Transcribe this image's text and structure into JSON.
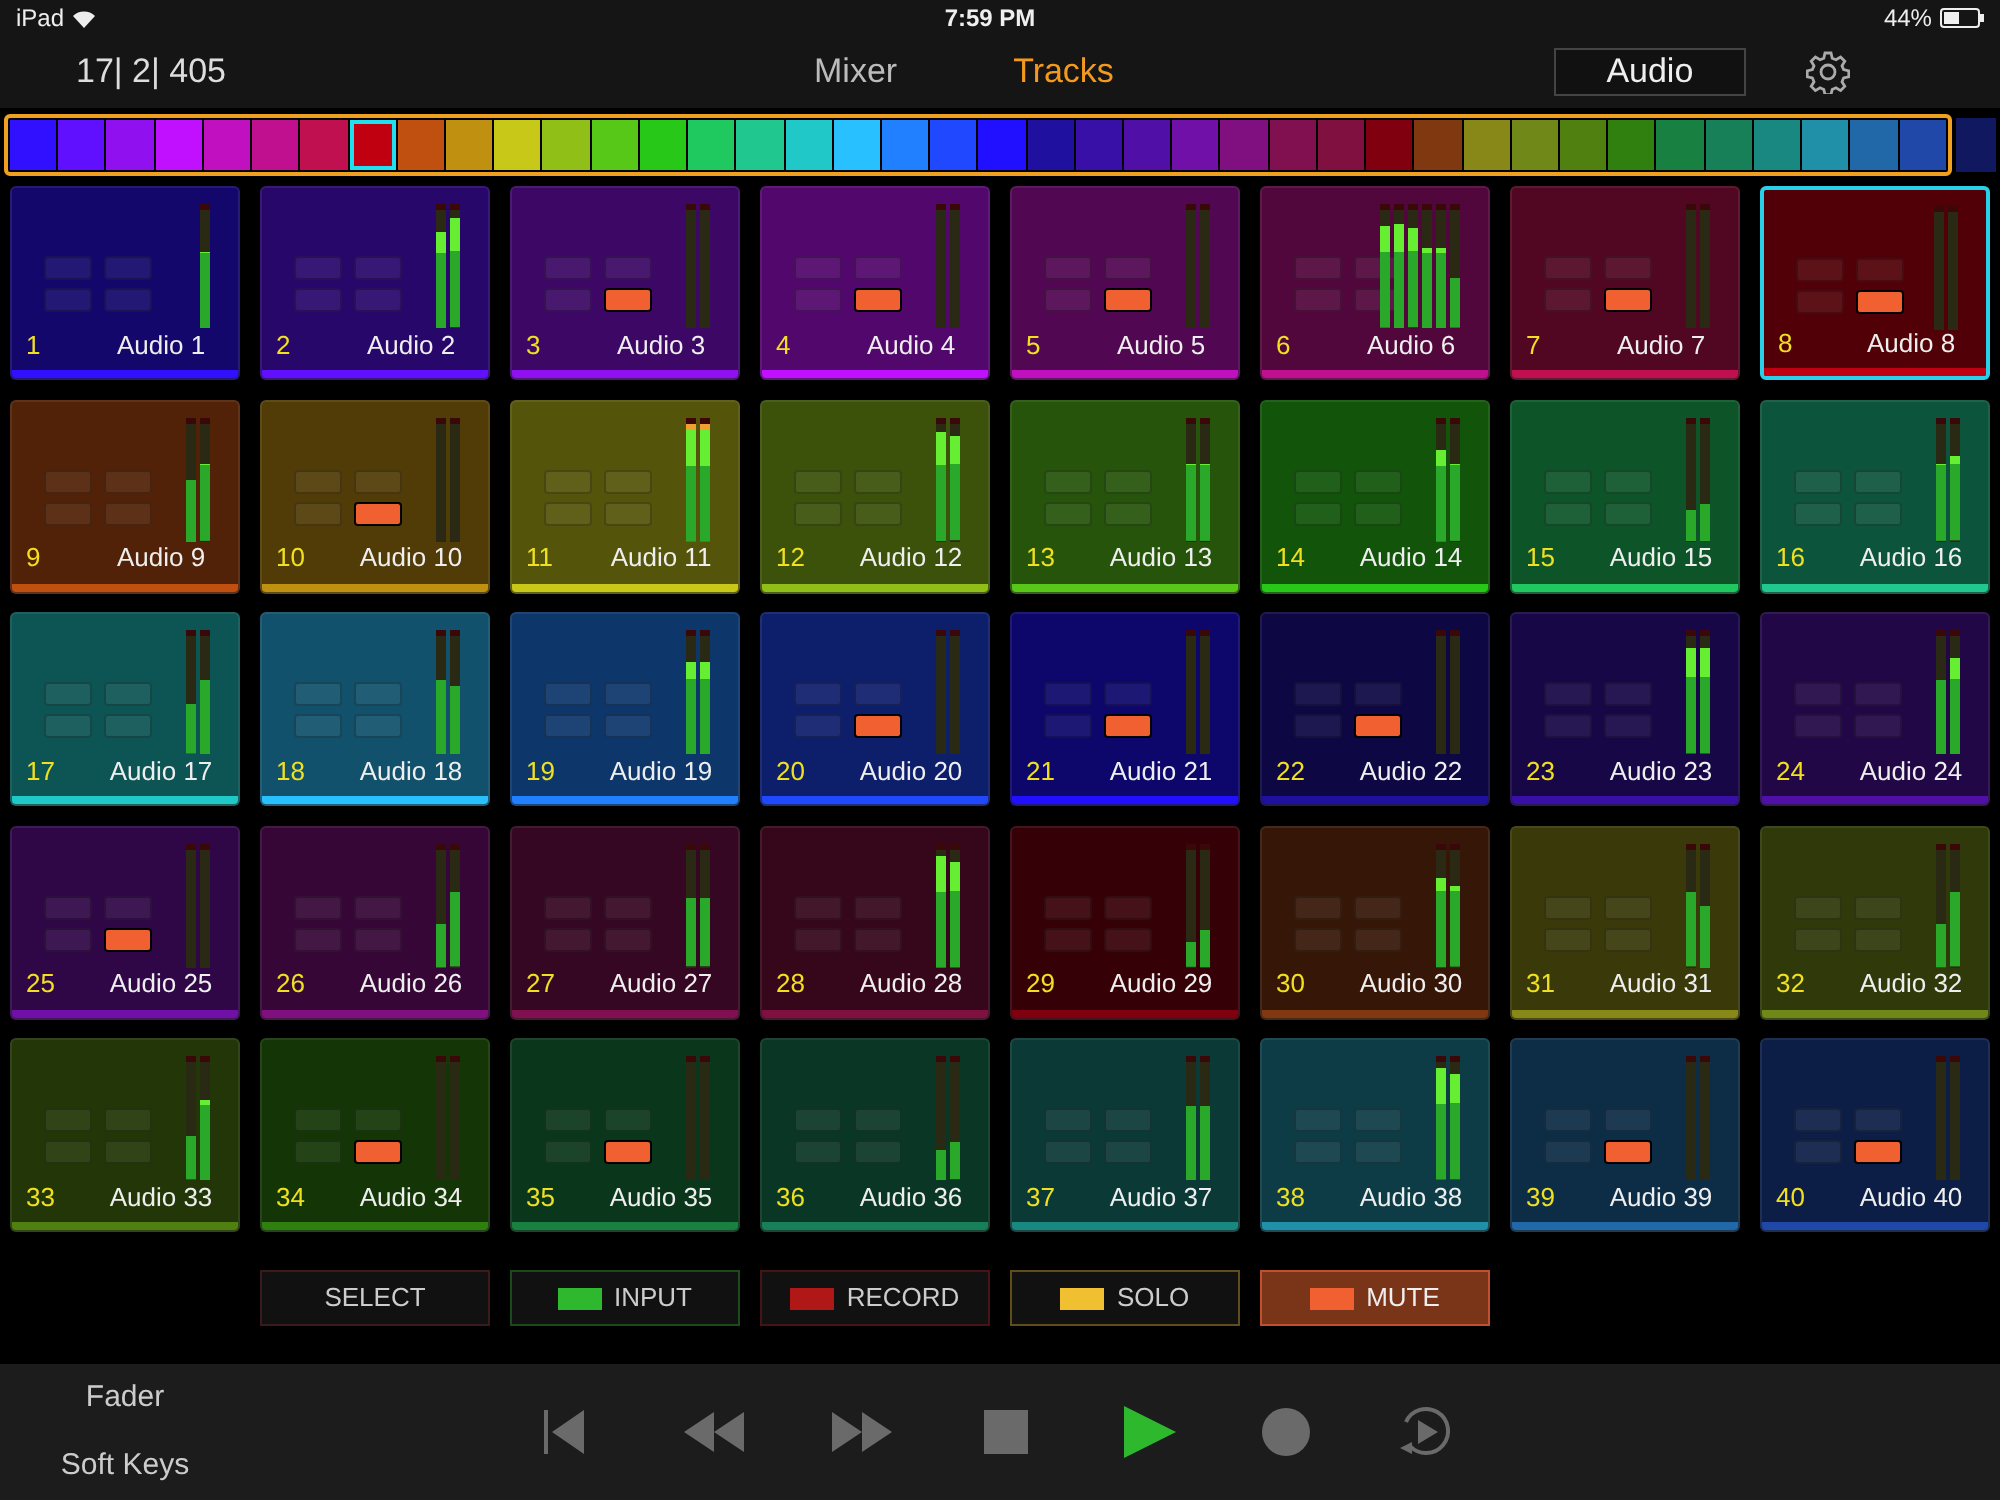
{
  "status_bar": {
    "device": "iPad",
    "time": "7:59 PM",
    "battery": "44%"
  },
  "header": {
    "position": "17| 2| 405",
    "tabs": [
      {
        "label": "Mixer",
        "selected": false
      },
      {
        "label": "Tracks",
        "selected": true
      }
    ],
    "bank_button": "Audio"
  },
  "tracks": [
    {
      "number": "1",
      "name": "Audio 1",
      "color": "#3010ff",
      "muted": false,
      "selected": false,
      "meters": [
        {
          "level": 0.62
        }
      ]
    },
    {
      "number": "2",
      "name": "Audio 2",
      "color": "#6010ff",
      "muted": false,
      "selected": false,
      "meters": [
        {
          "level": 0.78
        },
        {
          "level": 0.88
        }
      ]
    },
    {
      "number": "3",
      "name": "Audio 3",
      "color": "#9010f0",
      "muted": true,
      "selected": false,
      "meters": [
        {
          "level": 0
        },
        {
          "level": 0
        }
      ]
    },
    {
      "number": "4",
      "name": "Audio 4",
      "color": "#c010ff",
      "muted": true,
      "selected": false,
      "meters": [
        {
          "level": 0
        },
        {
          "level": 0
        }
      ]
    },
    {
      "number": "5",
      "name": "Audio 5",
      "color": "#c010c0",
      "muted": true,
      "selected": false,
      "meters": [
        {
          "level": 0
        },
        {
          "level": 0
        }
      ]
    },
    {
      "number": "6",
      "name": "Audio 6",
      "color": "#c01090",
      "muted": false,
      "selected": false,
      "meters": [
        {
          "level": 0.82
        },
        {
          "level": 0.84
        },
        {
          "level": 0.8
        },
        {
          "level": 0.65
        },
        {
          "level": 0.65
        },
        {
          "level": 0.4
        }
      ]
    },
    {
      "number": "7",
      "name": "Audio 7",
      "color": "#c01050",
      "muted": true,
      "selected": false,
      "meters": [
        {
          "level": 0
        },
        {
          "level": 0
        }
      ]
    },
    {
      "number": "8",
      "name": "Audio 8",
      "color": "#c00010",
      "muted": true,
      "selected": true,
      "meters": [
        {
          "level": 0
        },
        {
          "level": 0
        }
      ]
    },
    {
      "number": "9",
      "name": "Audio 9",
      "color": "#c05010",
      "muted": false,
      "selected": false,
      "meters": [
        {
          "level": 0.5
        },
        {
          "level": 0.62
        }
      ]
    },
    {
      "number": "10",
      "name": "Audio 10",
      "color": "#c09010",
      "muted": true,
      "selected": false,
      "meters": [
        {
          "level": 0
        },
        {
          "level": 0
        }
      ]
    },
    {
      "number": "11",
      "name": "Audio 11",
      "color": "#c8c818",
      "muted": false,
      "selected": false,
      "meters": [
        {
          "level": 0.95
        },
        {
          "level": 0.95
        }
      ]
    },
    {
      "number": "12",
      "name": "Audio 12",
      "color": "#90c018",
      "muted": false,
      "selected": false,
      "meters": [
        {
          "level": 0.88
        },
        {
          "level": 0.84
        }
      ]
    },
    {
      "number": "13",
      "name": "Audio 13",
      "color": "#58c818",
      "muted": false,
      "selected": false,
      "meters": [
        {
          "level": 0.62
        },
        {
          "level": 0.62
        }
      ]
    },
    {
      "number": "14",
      "name": "Audio 14",
      "color": "#28c818",
      "muted": false,
      "selected": false,
      "meters": [
        {
          "level": 0.74
        },
        {
          "level": 0.62
        }
      ]
    },
    {
      "number": "15",
      "name": "Audio 15",
      "color": "#20c860",
      "muted": false,
      "selected": false,
      "meters": [
        {
          "level": 0.25
        },
        {
          "level": 0.3
        }
      ]
    },
    {
      "number": "16",
      "name": "Audio 16",
      "color": "#20c890",
      "muted": false,
      "selected": false,
      "meters": [
        {
          "level": 0.62
        },
        {
          "level": 0.68
        }
      ]
    },
    {
      "number": "17",
      "name": "Audio 17",
      "color": "#20c8c8",
      "muted": false,
      "selected": false,
      "meters": [
        {
          "level": 0.4
        },
        {
          "level": 0.6
        }
      ]
    },
    {
      "number": "18",
      "name": "Audio 18",
      "color": "#28c0ff",
      "muted": false,
      "selected": false,
      "meters": [
        {
          "level": 0.6
        },
        {
          "level": 0.55
        }
      ]
    },
    {
      "number": "19",
      "name": "Audio 19",
      "color": "#2080ff",
      "muted": false,
      "selected": false,
      "meters": [
        {
          "level": 0.75
        },
        {
          "level": 0.75
        }
      ]
    },
    {
      "number": "20",
      "name": "Audio 20",
      "color": "#2048ff",
      "muted": true,
      "selected": false,
      "meters": [
        {
          "level": 0
        },
        {
          "level": 0
        }
      ]
    },
    {
      "number": "21",
      "name": "Audio 21",
      "color": "#2010ff",
      "muted": true,
      "selected": false,
      "meters": [
        {
          "level": 0
        },
        {
          "level": 0
        }
      ]
    },
    {
      "number": "22",
      "name": "Audio 22",
      "color": "#2010a0",
      "muted": true,
      "selected": false,
      "meters": [
        {
          "level": 0
        },
        {
          "level": 0
        }
      ]
    },
    {
      "number": "23",
      "name": "Audio 23",
      "color": "#3810a8",
      "muted": false,
      "selected": false,
      "meters": [
        {
          "level": 0.85
        },
        {
          "level": 0.85
        }
      ]
    },
    {
      "number": "24",
      "name": "Audio 24",
      "color": "#5010a8",
      "muted": false,
      "selected": false,
      "meters": [
        {
          "level": 0.6
        },
        {
          "level": 0.78
        }
      ]
    },
    {
      "number": "25",
      "name": "Audio 25",
      "color": "#7010a8",
      "muted": true,
      "selected": false,
      "meters": [
        {
          "level": 0
        },
        {
          "level": 0
        }
      ]
    },
    {
      "number": "26",
      "name": "Audio 26",
      "color": "#801080",
      "muted": false,
      "selected": false,
      "meters": [
        {
          "level": 0.35
        },
        {
          "level": 0.6
        }
      ]
    },
    {
      "number": "27",
      "name": "Audio 27",
      "color": "#801050",
      "muted": false,
      "selected": false,
      "meters": [
        {
          "level": 0.55
        },
        {
          "level": 0.55
        }
      ]
    },
    {
      "number": "28",
      "name": "Audio 28",
      "color": "#801040",
      "muted": false,
      "selected": false,
      "meters": [
        {
          "level": 0.9
        },
        {
          "level": 0.85
        }
      ]
    },
    {
      "number": "29",
      "name": "Audio 29",
      "color": "#800010",
      "muted": false,
      "selected": false,
      "meters": [
        {
          "level": 0.2
        },
        {
          "level": 0.3
        }
      ]
    },
    {
      "number": "30",
      "name": "Audio 30",
      "color": "#803810",
      "muted": false,
      "selected": false,
      "meters": [
        {
          "level": 0.72
        },
        {
          "level": 0.65
        }
      ]
    },
    {
      "number": "31",
      "name": "Audio 31",
      "color": "#888818",
      "muted": false,
      "selected": false,
      "meters": [
        {
          "level": 0.6
        },
        {
          "level": 0.5
        }
      ]
    },
    {
      "number": "32",
      "name": "Audio 32",
      "color": "#708818",
      "muted": false,
      "selected": false,
      "meters": [
        {
          "level": 0.35
        },
        {
          "level": 0.6
        }
      ]
    },
    {
      "number": "33",
      "name": "Audio 33",
      "color": "#508010",
      "muted": false,
      "selected": false,
      "meters": [
        {
          "level": 0.35
        },
        {
          "level": 0.65
        }
      ]
    },
    {
      "number": "34",
      "name": "Audio 34",
      "color": "#308010",
      "muted": true,
      "selected": false,
      "meters": [
        {
          "level": 0
        },
        {
          "level": 0
        }
      ]
    },
    {
      "number": "35",
      "name": "Audio 35",
      "color": "#188040",
      "muted": true,
      "selected": false,
      "meters": [
        {
          "level": 0
        },
        {
          "level": 0
        }
      ]
    },
    {
      "number": "36",
      "name": "Audio 36",
      "color": "#188058",
      "muted": false,
      "selected": false,
      "meters": [
        {
          "level": 0.25
        },
        {
          "level": 0.3
        }
      ]
    },
    {
      "number": "37",
      "name": "Audio 37",
      "color": "#188880",
      "muted": false,
      "selected": false,
      "meters": [
        {
          "level": 0.6
        },
        {
          "level": 0.6
        }
      ]
    },
    {
      "number": "38",
      "name": "Audio 38",
      "color": "#2090a8",
      "muted": false,
      "selected": false,
      "meters": [
        {
          "level": 0.9
        },
        {
          "level": 0.85
        }
      ]
    },
    {
      "number": "39",
      "name": "Audio 39",
      "color": "#2068a8",
      "muted": true,
      "selected": false,
      "meters": [
        {
          "level": 0
        },
        {
          "level": 0
        }
      ]
    },
    {
      "number": "40",
      "name": "Audio 40",
      "color": "#2048a8",
      "muted": true,
      "selected": false,
      "meters": [
        {
          "level": 0
        },
        {
          "level": 0
        }
      ]
    }
  ],
  "modes": [
    {
      "label": "SELECT",
      "selected": false
    },
    {
      "label": "INPUT",
      "color": "#2eb82e",
      "selected": false
    },
    {
      "label": "RECORD",
      "color": "#b01818",
      "selected": false
    },
    {
      "label": "SOLO",
      "color": "#f0c030",
      "selected": false
    },
    {
      "label": "MUTE",
      "color": "#f06030",
      "selected": true
    }
  ],
  "bottom_bar": {
    "views": [
      "Fader",
      "Soft Keys"
    ],
    "playing": true
  }
}
